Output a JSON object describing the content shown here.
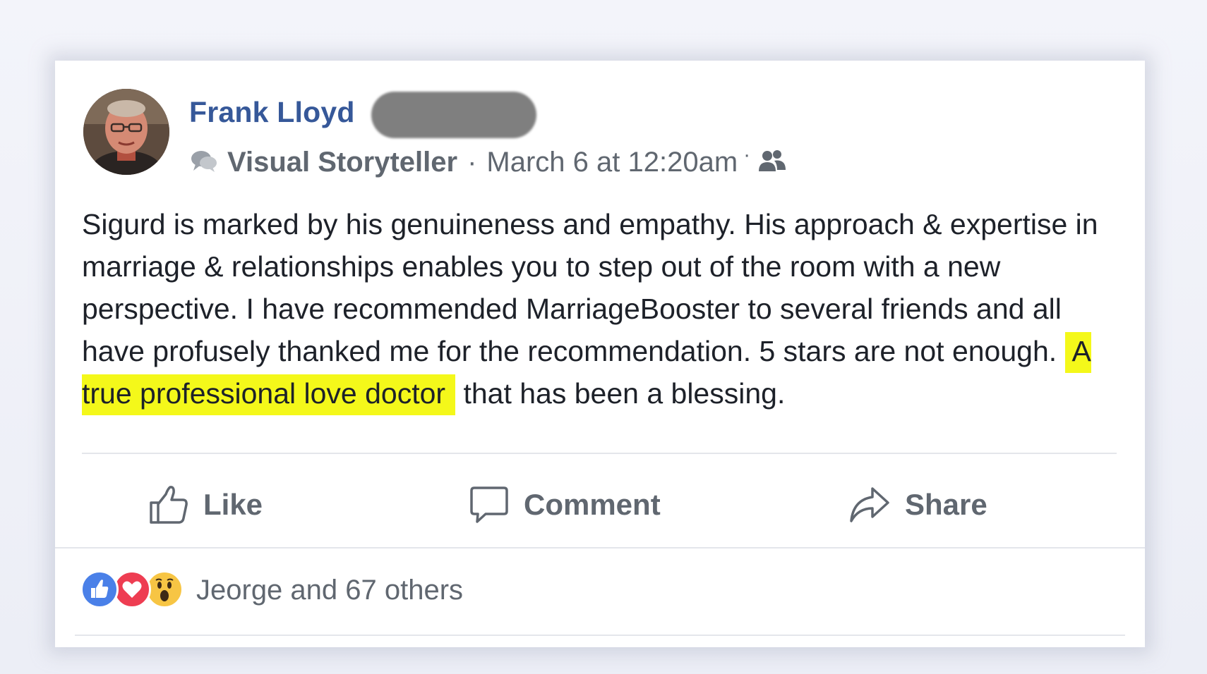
{
  "post": {
    "author_name": "Frank Lloyd",
    "badge_icon": "speech-bubbles-icon",
    "badge_label": "Visual Storyteller",
    "separator": "·",
    "timestamp": "March 6 at 12:20am",
    "audience_separator": "·",
    "audience_icon": "friends-icon",
    "body_before_highlight": "Sigurd is marked by his genuineness and empathy. His approach & expertise in marriage & relationships enables you to step out of the room with a new perspective. I have recommended MarriageBooster to several friends and all have profusely thanked me for the recommendation. 5 stars are not enough. ",
    "body_highlight": "A true professional love doctor",
    "body_after_highlight": " that has been a blessing.",
    "highlight_color": "#f4f81a",
    "name_color": "#365899"
  },
  "actions": {
    "like_label": "Like",
    "like_icon": "thumbs-up-icon",
    "comment_label": "Comment",
    "comment_icon": "comment-bubble-icon",
    "share_label": "Share",
    "share_icon": "share-arrow-icon"
  },
  "reactions": {
    "icons": [
      "like-reaction-icon",
      "love-reaction-icon",
      "wow-reaction-icon"
    ],
    "summary": "Jeorge and 67 others"
  }
}
